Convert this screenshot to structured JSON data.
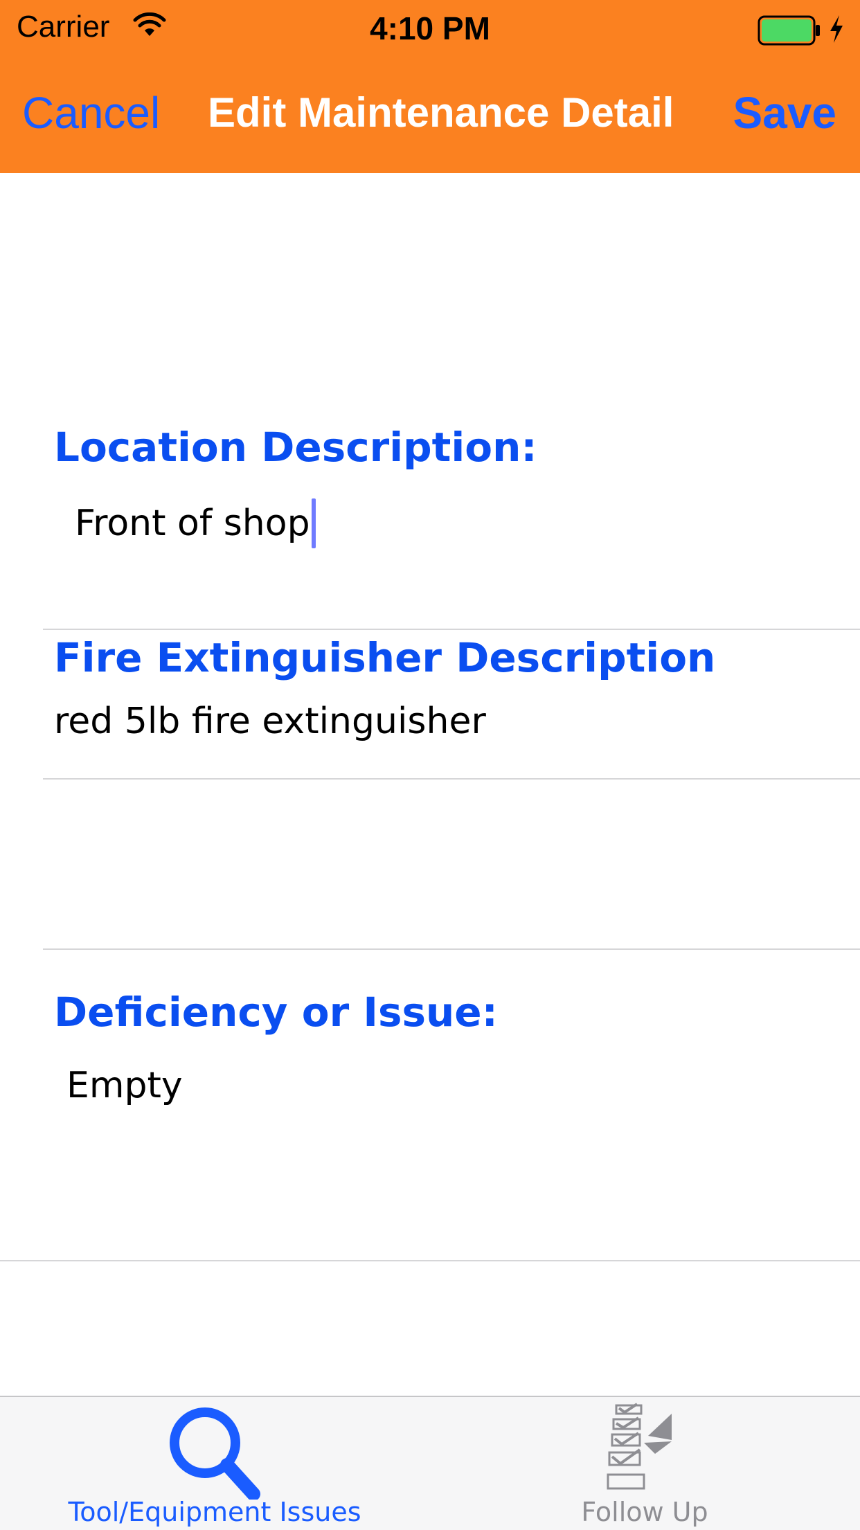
{
  "status_bar": {
    "carrier": "Carrier",
    "time": "4:10 PM",
    "battery_icon": "battery-full-icon",
    "charging_icon": "charging-bolt-icon",
    "wifi_icon": "wifi-icon"
  },
  "nav": {
    "cancel_label": "Cancel",
    "title": "Edit Maintenance Detail",
    "save_label": "Save"
  },
  "form": {
    "location": {
      "label": "Location Description:",
      "value": "Front of shop"
    },
    "extinguisher": {
      "label": "Fire Extinguisher Description",
      "value": "red 5lb fire extinguisher"
    },
    "deficiency": {
      "label": "Deficiency or Issue:",
      "value": "Empty"
    }
  },
  "tab_bar": {
    "tabs": [
      {
        "label": "Tool/Equipment Issues",
        "icon": "magnifier-icon",
        "selected": true
      },
      {
        "label": "Follow Up",
        "icon": "checklist-icon",
        "selected": false
      }
    ]
  },
  "colors": {
    "header_bg": "#fb8120",
    "accent_blue": "#1a5cff",
    "label_blue": "#0a4ef0",
    "tab_inactive": "#8e8e93"
  }
}
